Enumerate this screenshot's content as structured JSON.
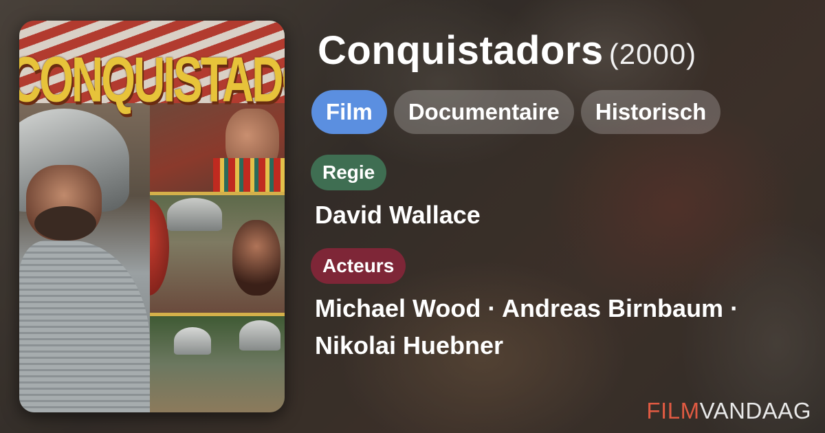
{
  "film": {
    "title": "Conquistadors",
    "year": "(2000)",
    "poster_text": "CONQUISTADOR"
  },
  "genres": [
    "Film",
    "Documentaire",
    "Historisch"
  ],
  "genre_colors": {
    "active": "#5b8fe0",
    "inactive": "rgba(255,255,255,0.22)"
  },
  "credits": {
    "director_label": "Regie",
    "director": "David Wallace",
    "cast_label": "Acteurs",
    "cast": "Michael Wood · Andreas Birnbaum · Nikolai Huebner"
  },
  "label_colors": {
    "regie": "#3f6e52",
    "acteurs": "#7e2637"
  },
  "brand": {
    "part1": "FILM",
    "part2": "VANDAAG",
    "color1": "#e05a42",
    "color2": "#e8e8e8"
  }
}
